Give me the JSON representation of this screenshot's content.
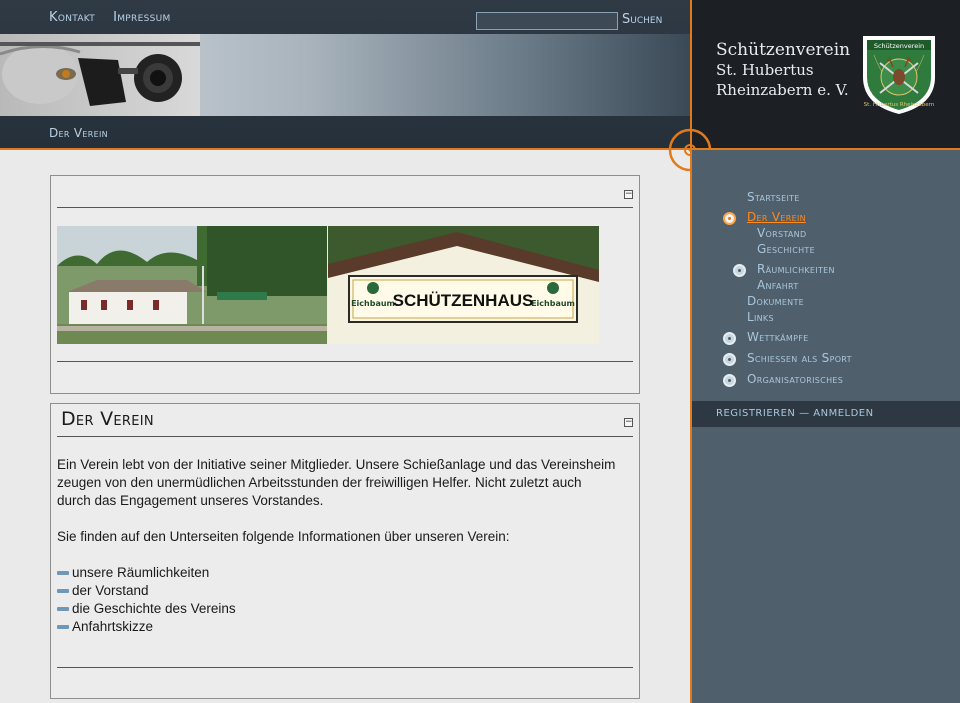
{
  "topnav": {
    "contact": "Kontakt",
    "imprint": "Impressum"
  },
  "search": {
    "placeholder": "",
    "button_label": "Suchen"
  },
  "breadcrumb": "Der Verein",
  "club": {
    "line1": "Schützenverein",
    "line2": "St. Hubertus",
    "line3": "Rheinzabern e. V."
  },
  "crest": {
    "top_text": "Schützenverein",
    "ring_text": "St. Hubertus Rheinzabern"
  },
  "sidebar": {
    "items": [
      {
        "label": "Startseite",
        "level": 0,
        "bullet": false,
        "active": false
      },
      {
        "label": "Der Verein",
        "level": 0,
        "bullet": true,
        "active": true
      },
      {
        "label": "Vorstand",
        "level": 1,
        "bullet": false,
        "active": false
      },
      {
        "label": "Geschichte",
        "level": 1,
        "bullet": false,
        "active": false
      },
      {
        "label": "Räumlichkeiten",
        "level": 1,
        "bullet": true,
        "active": false
      },
      {
        "label": "Anfahrt",
        "level": 1,
        "bullet": false,
        "active": false
      },
      {
        "label": "Dokumente",
        "level": 0,
        "bullet": false,
        "active": false
      },
      {
        "label": "Links",
        "level": 0,
        "bullet": false,
        "active": false
      },
      {
        "label": "Wettkämpfe",
        "level": 0,
        "bullet": true,
        "active": false
      },
      {
        "label": "Schiessen als Sport",
        "level": 0,
        "bullet": true,
        "active": false
      },
      {
        "label": "Organisatorisches",
        "level": 0,
        "bullet": true,
        "active": false
      }
    ],
    "register": "REGISTRIEREN",
    "separator": "—",
    "login": "ANMELDEN"
  },
  "photo": {
    "sign_text": "SCHÜTZENHAUS",
    "brand_left": "Eichbaum",
    "brand_right": "Eichbaum"
  },
  "article": {
    "title": "Der Verein",
    "paragraph1": "Ein Verein lebt von der Initiative seiner Mitglieder. Unsere Schießanlage und das Vereinsheim zeugen von den unermüdlichen Arbeitsstunden der freiwilligen Helfer. Nicht zuletzt auch durch das Engagement unseres Vorstandes.",
    "paragraph2": "Sie finden auf den Unterseiten folgende Informationen über unseren Verein:",
    "links": [
      "unsere Räumlichkeiten",
      "der Vorstand",
      "die Geschichte des Vereins",
      "Anfahrtskizze"
    ]
  },
  "icons": {
    "collapse": "minus-box-icon",
    "bullet": "radio-bullet-icon"
  },
  "colors": {
    "accent": "#e07a1c",
    "sidebar_bg": "#4f5f6c",
    "link": "#a9c7dd"
  }
}
